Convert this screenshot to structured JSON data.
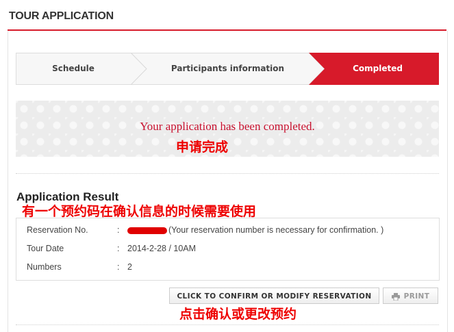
{
  "header": {
    "title": "TOUR APPLICATION"
  },
  "steps": [
    {
      "label": "Schedule",
      "active": false
    },
    {
      "label": "Participants information",
      "active": false
    },
    {
      "label": "Completed",
      "active": true
    }
  ],
  "banner": {
    "message": "Your application has been completed.",
    "annotation": "申请完成"
  },
  "result": {
    "title": "Application Result",
    "annotation": "有一个预约码在确认信息的时候需要使用",
    "rows": [
      {
        "label": "Reservation No.",
        "value": "(Your reservation number is necessary for confirmation. )"
      },
      {
        "label": "Tour Date",
        "value": "2014-2-28 / 10AM"
      },
      {
        "label": "Numbers",
        "value": "2"
      }
    ],
    "colon": ":"
  },
  "actions": {
    "confirm_label": "CLICK TO CONFIRM OR MODIFY RESERVATION",
    "print_label": "PRINT",
    "annotation": "点击确认或更改预约"
  },
  "colors": {
    "accent": "#d71a2a",
    "annotation": "#ee0000"
  }
}
